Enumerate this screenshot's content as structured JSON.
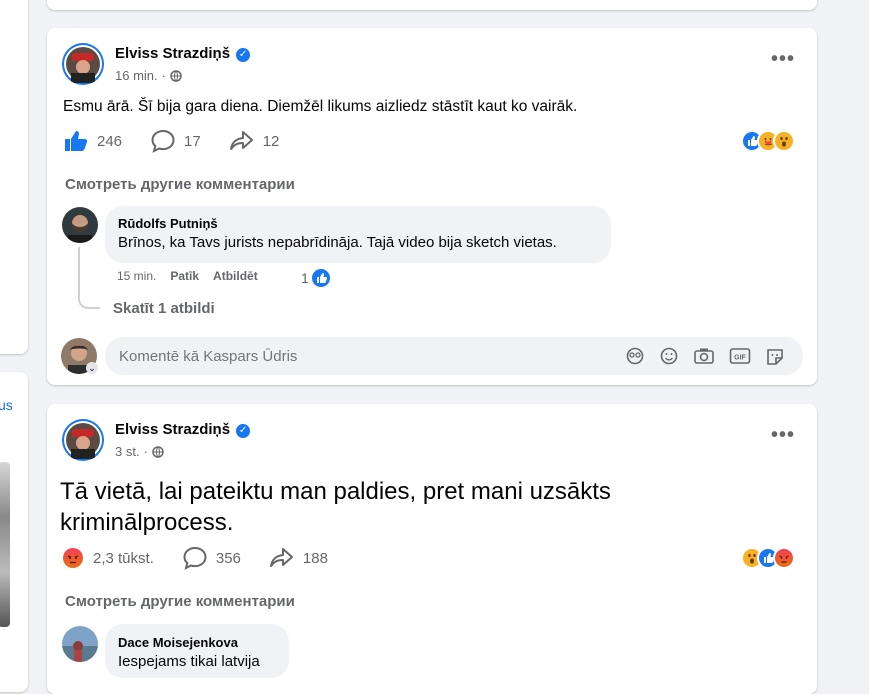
{
  "post1": {
    "author": "Elviss Strazdiņš",
    "time": "16 min.",
    "text": "Esmu ārā. Šī bija gara diena. Diemžēl likums aizliedz stāstīt kaut ko vairāk.",
    "reactions": "246",
    "comments": "17",
    "shares": "12",
    "more_comments": "Смотреть другие комментарии",
    "comment": {
      "name": "Rūdolfs Putniņš",
      "text": "Brīnos, ka Tavs jurists nepabrīdināja. Tajā video bija sketch vietas.",
      "time": "15 min.",
      "like": "Patīk",
      "reply": "Atbildēt",
      "reaction_count": "1"
    },
    "view_replies": "Skatīt 1 atbildi",
    "input_placeholder": "Komentē kā Kaspars Ūdris"
  },
  "post2": {
    "author": "Elviss Strazdiņš",
    "time": "3 st.",
    "text": "Tā vietā, lai pateiktu man paldies, pret mani uzsākts kriminālprocess.",
    "reactions": "2,3 tūkst.",
    "comments": "356",
    "shares": "188",
    "more_comments": "Смотреть другие комментарии",
    "comment": {
      "name": "Dace Moisejenkova",
      "text": "Iespejams tikai latvija"
    }
  },
  "left": {
    "link_fragment": "us"
  },
  "colors": {
    "accent": "#1877f2",
    "angry": "#e9710f",
    "wow": "#f7b125"
  }
}
